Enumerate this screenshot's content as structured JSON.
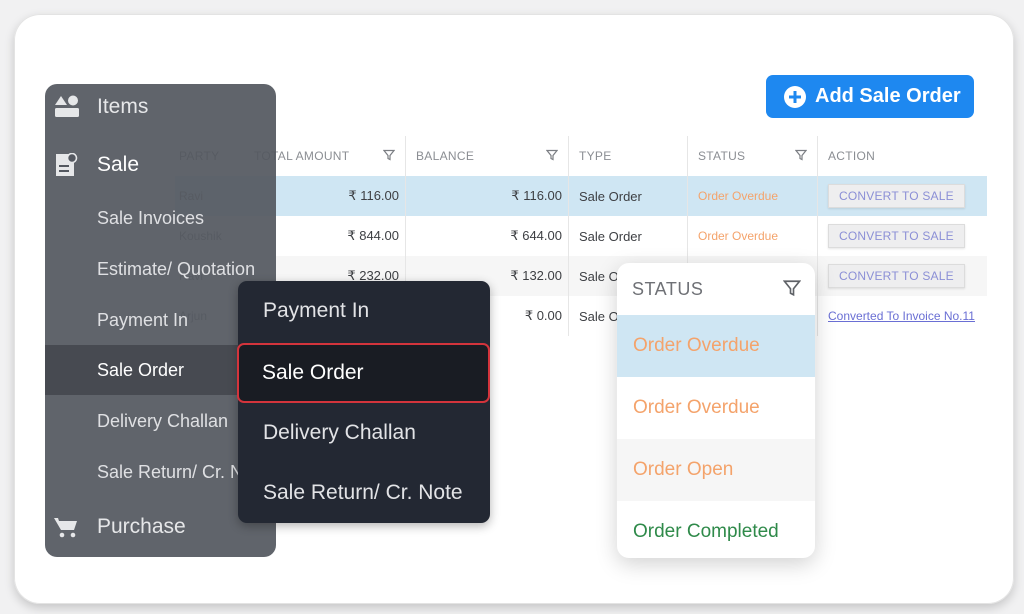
{
  "toolbar": {
    "add_label": "Add Sale Order"
  },
  "table": {
    "columns": {
      "party": "PARTY",
      "total": "TOTAL AMOUNT",
      "balance": "BALANCE",
      "type": "TYPE",
      "status": "STATUS",
      "action": "ACTION"
    },
    "rows": [
      {
        "party": "Ravi",
        "total": "₹ 116.00",
        "balance": "₹ 116.00",
        "type": "Sale Order",
        "status": "Order Overdue",
        "action": "CONVERT TO SALE"
      },
      {
        "party": "Koushik",
        "total": "₹ 844.00",
        "balance": "₹ 644.00",
        "type": "Sale Order",
        "status": "Order Overdue",
        "action": "CONVERT TO SALE"
      },
      {
        "party": "Ravi",
        "total": "₹ 232.00",
        "balance": "₹ 132.00",
        "type": "Sale Order",
        "status": "",
        "action": "CONVERT TO SALE"
      },
      {
        "party": "Arjun",
        "total": "",
        "balance": "₹ 0.00",
        "type": "Sale Order",
        "status": "",
        "action": "Converted To Invoice No.11"
      }
    ]
  },
  "sidebar": {
    "items_label": "Items",
    "sale_label": "Sale",
    "sale_sub": [
      "Sale Invoices",
      "Estimate/ Quotation",
      "Payment In",
      "Sale Order",
      "Delivery Challan",
      "Sale Return/ Cr. Note"
    ],
    "active_sub": "Sale Order",
    "purchase_label": "Purchase"
  },
  "submenu": {
    "items": [
      "Payment In",
      "Sale Order",
      "Delivery Challan",
      "Sale Return/ Cr. Note"
    ],
    "active": "Sale Order"
  },
  "status_filter": {
    "title": "STATUS",
    "options": [
      {
        "label": "Order Overdue",
        "color": "#f4a36b"
      },
      {
        "label": "Order Overdue",
        "color": "#f4a36b"
      },
      {
        "label": "Order Open",
        "color": "#f4a36b"
      },
      {
        "label": "Order Completed",
        "color": "#2f8a4a"
      }
    ]
  },
  "colors": {
    "accent": "#1e88f0",
    "overdue": "#f4a36b",
    "completed": "#2f8a4a",
    "highlight": "#cfe6f3",
    "active_border": "#d3343c"
  }
}
